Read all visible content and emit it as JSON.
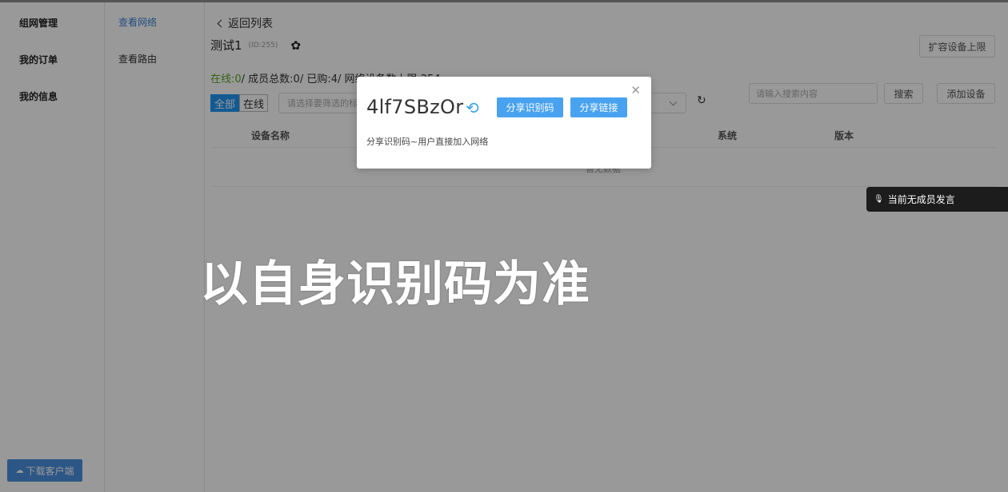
{
  "nav_primary": [
    "组网管理",
    "我的订单",
    "我的信息"
  ],
  "download_label": "下载客户端",
  "nav_secondary": [
    "查看网络",
    "查看路由"
  ],
  "back_label": "返回列表",
  "network": {
    "name": "测试1",
    "id_text": "(ID:255)"
  },
  "expand_label": "扩容设备上限",
  "stats": {
    "online": "在线:0",
    "rest": "/ 成员总数:0/ 已购:4/ 网络设备数上限:254"
  },
  "filter": {
    "all": "全部",
    "online": "在线",
    "placeholder": "请选择要筛选的标签"
  },
  "search": {
    "placeholder": "请输入搜索内容",
    "button": "搜索"
  },
  "add_label": "添加设备",
  "table": {
    "headers": [
      "设备名称",
      "系统",
      "版本"
    ],
    "empty_text": "暂无数据"
  },
  "modal": {
    "code": "4lf7SBzOr",
    "share_code_label": "分享识别码",
    "share_link_label": "分享链接",
    "description": "分享识别码~用户直接加入网络"
  },
  "toast": "当前无成员发言",
  "caption": "以自身识别码为准",
  "icons": {
    "back": "chevron-left-icon",
    "settings": "gear-icon",
    "refresh": "refresh-icon",
    "sync": "sync-icon",
    "close": "close-icon",
    "mic": "microphone-icon",
    "cloud": "cloud-upload-icon"
  },
  "colors": {
    "accent": "#49a2f0",
    "nav_active": "#3b82d6",
    "online_green": "#58a722",
    "toast_bg": "#1c1c1c"
  }
}
